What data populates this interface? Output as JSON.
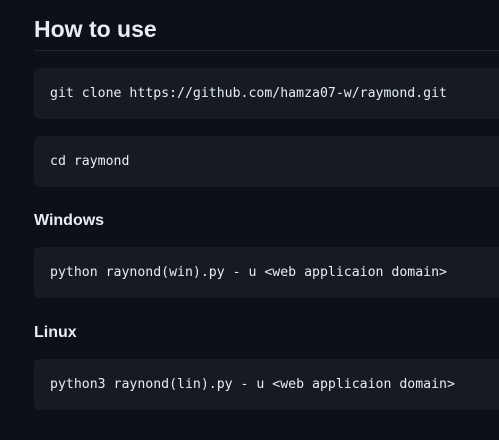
{
  "section": {
    "title": "How to use"
  },
  "steps": {
    "clone_command": "git clone https://github.com/hamza07-w/raymond.git",
    "cd_command": "cd raymond"
  },
  "windows": {
    "label": "Windows",
    "command": "python raynond(win).py - u <web applicaion domain>"
  },
  "linux": {
    "label": "Linux",
    "command": "python3 raynond(lin).py - u <web applicaion domain>"
  },
  "colors": {
    "page_background": "#0d1117",
    "code_background": "#161b22",
    "text": "#e6edf3",
    "rule": "#21262d"
  }
}
